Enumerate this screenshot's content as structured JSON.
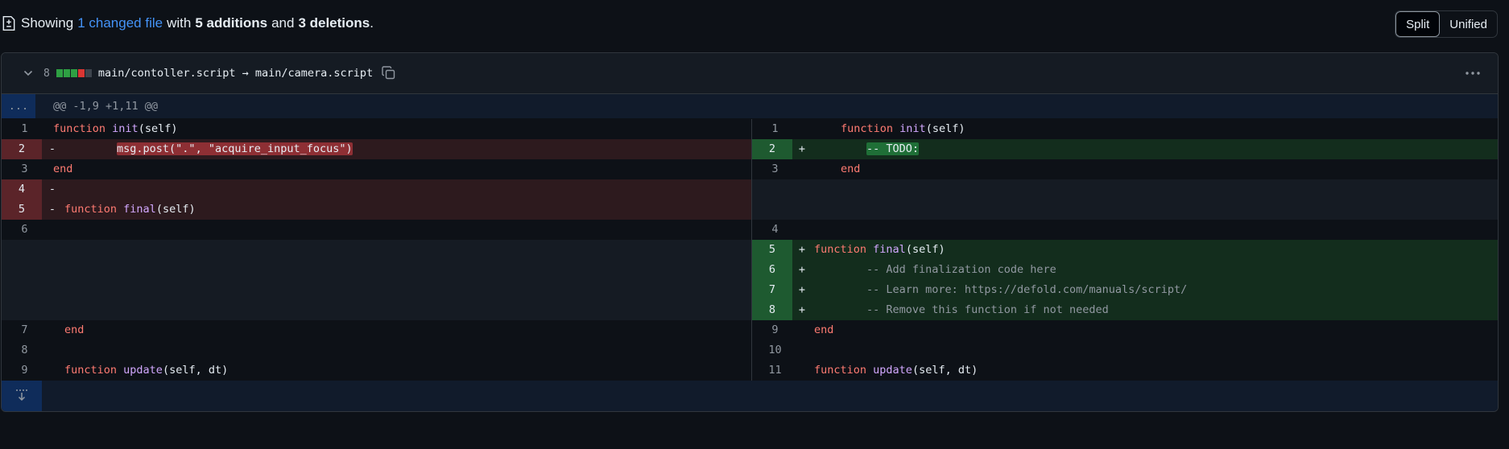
{
  "summary": {
    "prefix": "Showing",
    "changed": "1 changed file",
    "with": "with",
    "additions": "5 additions",
    "and": "and",
    "deletions": "3 deletions",
    "period": "."
  },
  "view_toggle": {
    "split": "Split",
    "unified": "Unified",
    "selected": "Split"
  },
  "file": {
    "changes": "8",
    "path": "main/contoller.script → main/camera.script"
  },
  "hunk": {
    "expander": "...",
    "header": "@@ -1,9 +1,11 @@"
  },
  "left": {
    "n1": "1",
    "n2": "2",
    "n3": "3",
    "n4": "4",
    "n5": "5",
    "n6": "6",
    "n7": "7",
    "n8": "8",
    "n9": "9",
    "s2": "-",
    "s4": "-",
    "s5": "-",
    "l1_kw": "function",
    "l1_fn": "init",
    "l1_rest": "(self)",
    "l2_indent": "        ",
    "l2_mark": "msg.post(\".\", \"acquire_input_focus\")",
    "l3_kw": "end",
    "l5_kw": "function",
    "l5_fn": "final",
    "l5_rest": "(self)",
    "l7_kw": "end",
    "l9_kw": "function",
    "l9_fn": "update",
    "l9_rest": "(self, dt)"
  },
  "right": {
    "n1": "1",
    "n2": "2",
    "n3": "3",
    "n4": "4",
    "n5": "5",
    "n6": "6",
    "n7": "7",
    "n8": "8",
    "n9": "9",
    "n10": "10",
    "n11": "11",
    "s2": "+",
    "s5": "+",
    "s6": "+",
    "s7": "+",
    "s8": "+",
    "l1_kw": "function",
    "l1_fn": "init",
    "l1_rest": "(self)",
    "l2_indent": "        ",
    "l2_mark": "-- TODO:",
    "l3_kw": "end",
    "l5_kw": "function",
    "l5_fn": "final",
    "l5_rest": "(self)",
    "l6": "        -- Add finalization code here",
    "l7": "        -- Learn more: https://defold.com/manuals/script/",
    "l8": "        -- Remove this function if not needed",
    "l9_kw": "end",
    "l11_kw": "function",
    "l11_fn": "update",
    "l11_rest": "(self, dt)"
  },
  "colors": {
    "del_bg": "#2d1a1e",
    "del_num_bg": "#5b2429",
    "add_bg": "#132d1d",
    "add_num_bg": "#1e5a30",
    "empty_bg": "#151b23",
    "hunk_bg": "#111b2b",
    "expander_bg": "#0f2c5a",
    "link": "#4493f8"
  },
  "icons": [
    "file-diff-icon",
    "chevron-down-icon",
    "copy-icon",
    "kebab-horizontal-icon",
    "expand-down-icon"
  ]
}
